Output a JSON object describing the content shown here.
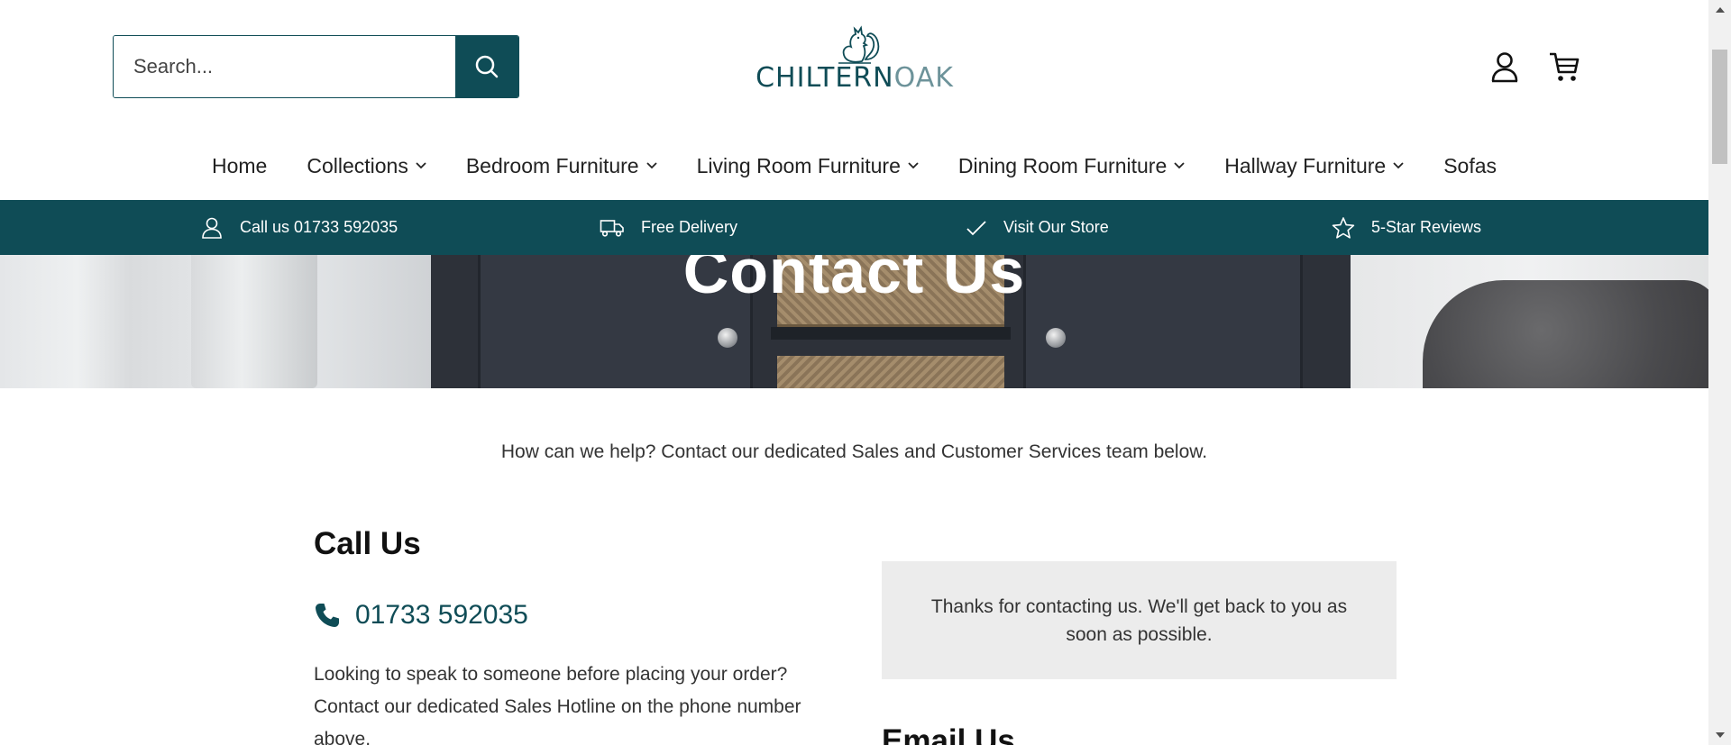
{
  "header": {
    "search_placeholder": "Search...",
    "logo": {
      "part1": "CHILTERN",
      "part2": "OAK"
    }
  },
  "nav": {
    "items": [
      {
        "label": "Home",
        "has_dropdown": false
      },
      {
        "label": "Collections",
        "has_dropdown": true
      },
      {
        "label": "Bedroom Furniture",
        "has_dropdown": true
      },
      {
        "label": "Living Room Furniture",
        "has_dropdown": true
      },
      {
        "label": "Dining Room Furniture",
        "has_dropdown": true
      },
      {
        "label": "Hallway Furniture",
        "has_dropdown": true
      },
      {
        "label": "Sofas",
        "has_dropdown": false
      }
    ]
  },
  "usp": {
    "items": [
      {
        "label": "Call us 01733 592035",
        "icon": "person-icon"
      },
      {
        "label": "Free Delivery",
        "icon": "truck-icon"
      },
      {
        "label": "Visit Our Store",
        "icon": "check-icon"
      },
      {
        "label": "5-Star Reviews",
        "icon": "star-icon"
      }
    ]
  },
  "hero": {
    "title": "Contact Us"
  },
  "content": {
    "intro": "How can we help? Contact our dedicated Sales and Customer Services team below.",
    "call_title": "Call Us",
    "phone_number": "01733 592035",
    "call_description": "Looking to speak to someone before placing your order? Contact our dedicated Sales Hotline on the phone number above.",
    "thanks_message": "Thanks for contacting us. We'll get back to you as soon as possible.",
    "email_title": "Email Us"
  },
  "colors": {
    "brand": "#0f4c56",
    "brand_light": "#6d939a",
    "panel": "#ececec"
  }
}
